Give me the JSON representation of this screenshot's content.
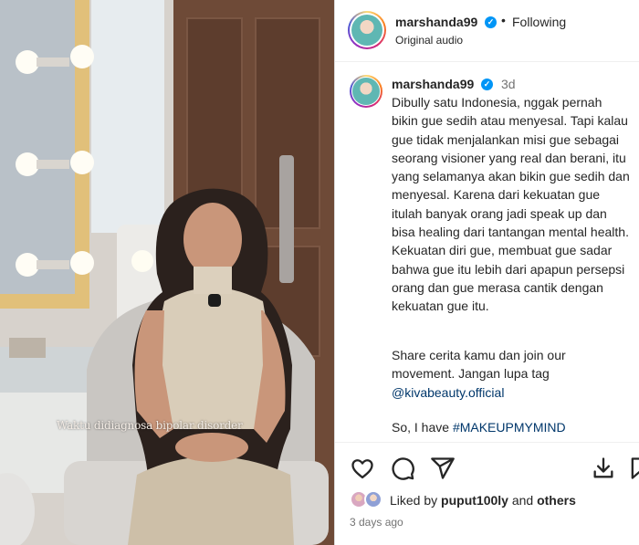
{
  "media": {
    "subtitle": "Waktu didiagnosa bipolar disorder"
  },
  "header": {
    "username": "marshanda99",
    "separator": "•",
    "follow_status": "Following",
    "audio_label": "Original audio"
  },
  "caption": {
    "username": "marshanda99",
    "time_ago": "3d",
    "paragraph_1": "Dibully satu Indonesia, nggak pernah bikin gue sedih atau menyesal. Tapi kalau gue tidak menjalankan misi gue sebagai seorang visioner yang real dan berani, itu yang selamanya akan bikin gue sedih dan menyesal. Karena dari kekuatan gue itulah banyak orang jadi speak up dan bisa healing dari tantangan mental health. Kekuatan diri gue, membuat gue sadar bahwa gue itu lebih dari apapun persepsi orang dan gue merasa cantik dengan kekuatan gue itu.",
    "paragraph_2": "Share cerita kamu dan join our movement. Jangan lupa tag",
    "mention": "@kivabeauty.official",
    "paragraph_3_prefix": "So, I have ",
    "hashtag": "#MAKEUPMYMIND"
  },
  "actions": {
    "icons": [
      "heart-icon",
      "comment-icon",
      "share-icon",
      "save-icon",
      "bookmark-icon"
    ],
    "liked_prefix": "Liked by ",
    "liked_user": "puput100ly",
    "liked_mid": " and ",
    "liked_others": "others",
    "date": "3 days ago"
  },
  "colors": {
    "verified_blue": "#0095f6",
    "link_blue": "#00376b",
    "secondary_text": "#737373"
  }
}
